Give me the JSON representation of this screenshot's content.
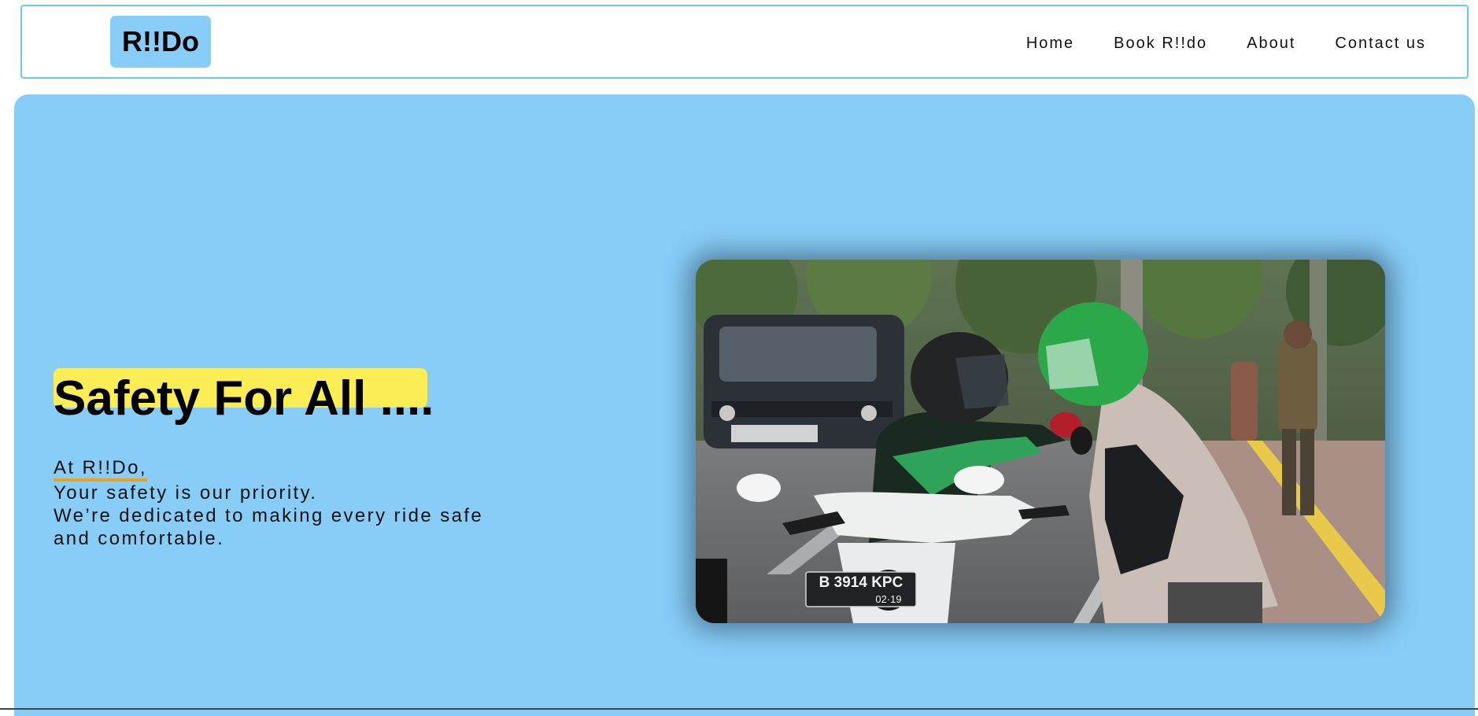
{
  "header": {
    "logo": "R!!Do",
    "nav": [
      "Home",
      "Book R!!do",
      "About",
      "Contact us"
    ]
  },
  "hero": {
    "headline": "Safety For All ....",
    "brand_line": "At R!!Do,",
    "lines": [
      "Your safety is our priority.",
      "We’re dedicated to making every ride safe",
      "and comfortable."
    ],
    "photo": {
      "plate_line1": "B 3914 KPC",
      "plate_line2": "02·19"
    }
  },
  "colors": {
    "accent_blue": "#87cdf8",
    "highlight_yellow": "#fbee55",
    "underline_orange": "#f0a11a",
    "nav_border": "#6cc8ee"
  }
}
